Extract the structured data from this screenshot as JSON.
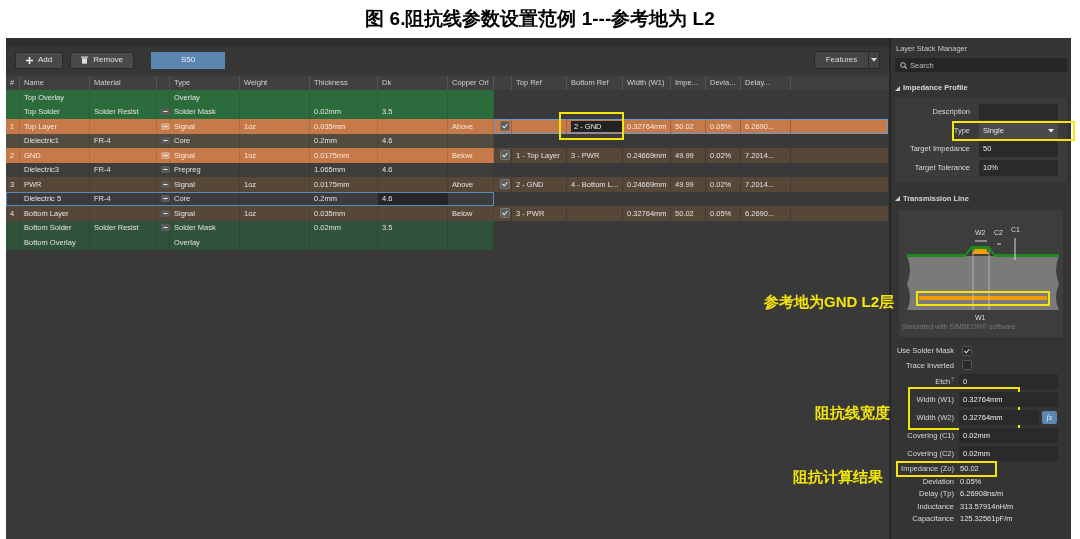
{
  "title": "图 6.阻抗线参数设置范例 1---参考地为 L2",
  "toolbar": {
    "buttons": [
      {
        "label": "Add",
        "kind": "add"
      },
      {
        "label": "Remove",
        "kind": "remove"
      }
    ],
    "tabs": [
      {
        "label": "S50",
        "selected": true
      }
    ],
    "features": "Features"
  },
  "columns": [
    "#",
    "Name",
    "Material",
    "Type",
    "Weight",
    "Thickness",
    "Dk",
    "Copper Ori"
  ],
  "impedance_columns": [
    "Top Ref",
    "Bottom Ref",
    "Width (W1)",
    "Impe...",
    "Devia...",
    "Delay..."
  ],
  "layers": [
    {
      "name": "Top Overlay",
      "type": "Overlay",
      "color": "#2c6b3b",
      "material_button": false,
      "selected": false
    },
    {
      "name": "Top Solder",
      "material": "Solder Resist",
      "type": "Solder Mask",
      "thickness": "0.02mm",
      "dk": "3.5",
      "color": "#2c6b3b",
      "material_button": true,
      "selected": false
    },
    {
      "number": "1",
      "name": "Top Layer",
      "type": "Signal",
      "weight": "1oz",
      "thickness": "0.035mm",
      "copper": "Above",
      "color": "#c67a4a",
      "material_button": true,
      "selected": false,
      "impedance": {
        "checked": true,
        "bottom_ref": "2 - GND",
        "width": "0.32764mm",
        "impedance": "50.02",
        "deviation": "0.05%",
        "delay": "6.2690...",
        "color": "#c67a4a",
        "selected": true,
        "annotated": true
      }
    },
    {
      "name": "Dielectric1",
      "material": "FR-4",
      "type": "Core",
      "thickness": "0.2mm",
      "dk": "4.6",
      "color": "#514b40",
      "material_button": true,
      "selected": false
    },
    {
      "number": "2",
      "name": "GND",
      "type": "Signal",
      "weight": "1oz",
      "thickness": "0.0175mm",
      "copper": "Below",
      "color": "#c67a4a",
      "material_button": true,
      "selected": false,
      "impedance": {
        "checked": true,
        "top_ref": "1 - Top Layer",
        "bottom_ref": "3 - PWR",
        "width": "0.24669mm",
        "impedance": "49.99",
        "deviation": "0.02%",
        "delay": "7.2014...",
        "color": "#574738",
        "selected": false,
        "annotated": false
      }
    },
    {
      "name": "Dielectric3",
      "material": "FR-4",
      "type": "Prepreg",
      "thickness": "1.065mm",
      "dk": "4.6",
      "color": "#403e3a",
      "material_button": true,
      "selected": false
    },
    {
      "number": "3",
      "name": "PWR",
      "type": "Signal",
      "weight": "1oz",
      "thickness": "0.0175mm",
      "copper": "Above",
      "color": "#574738",
      "material_button": true,
      "selected": false,
      "impedance": {
        "checked": true,
        "top_ref": "2 - GND",
        "bottom_ref": "4 - Bottom L...",
        "width": "0.24669mm",
        "impedance": "49.99",
        "deviation": "0.02%",
        "delay": "7.2014...",
        "color": "#574738",
        "selected": false,
        "annotated": false
      }
    },
    {
      "name": "Dielectric 5",
      "material": "FR-4",
      "type": "Core",
      "thickness": "0.2mm",
      "dk": "4.6",
      "color": "#3c3c3c",
      "material_button": true,
      "selected": true
    },
    {
      "number": "4",
      "name": "Bottom Layer",
      "type": "Signal",
      "weight": "1oz",
      "thickness": "0.035mm",
      "copper": "Below",
      "color": "#574738",
      "material_button": true,
      "selected": false,
      "impedance": {
        "checked": true,
        "top_ref": "3 - PWR",
        "width": "0.32764mm",
        "impedance": "50.02",
        "deviation": "0.05%",
        "delay": "6.2690...",
        "color": "#574738",
        "selected": false,
        "annotated": false
      }
    },
    {
      "name": "Bottom Solder",
      "material": "Solder Resist",
      "type": "Solder Mask",
      "thickness": "0.02mm",
      "dk": "3.5",
      "color": "#30513a",
      "material_button": true,
      "selected": false
    },
    {
      "name": "Bottom Overlay",
      "type": "Overlay",
      "color": "#30513a",
      "material_button": false,
      "selected": false
    }
  ],
  "panel": {
    "title": "Layer Stack Manager",
    "search_placeholder": "Search",
    "profile": {
      "heading": "Impedance Profile",
      "expanded": true,
      "fields": [
        {
          "label": "Description",
          "kind": "text",
          "annotated": false
        },
        {
          "label": "Type",
          "value": "Single",
          "kind": "dropdown",
          "annotated": true
        },
        {
          "label": "Target Impedance",
          "value": "50",
          "kind": "text",
          "annotated": false
        },
        {
          "label": "Target Tolerance",
          "value": "10%",
          "kind": "text",
          "annotated": false
        }
      ]
    },
    "transmission": {
      "heading": "Transmission Line",
      "expanded": true,
      "diagram": {
        "w2": "W2",
        "c2": "C2",
        "c1": "C1",
        "w1": "W1",
        "caption": "Simulated with SIMBEOR® software",
        "ground_annotated": true
      },
      "properties": [
        {
          "kind": "checkbox",
          "label": "Use Solder Mask",
          "checked": true,
          "annotated": false
        },
        {
          "kind": "checkbox",
          "label": "Trace Inverted",
          "checked": false,
          "annotated": false
        },
        {
          "kind": "field",
          "label": "Etch",
          "help": "?",
          "value": "0",
          "annotated": false
        },
        {
          "kind": "field",
          "label": "Width (W1)",
          "value": "0.32764mm",
          "annotated": true
        },
        {
          "kind": "field",
          "label": "Width (W2)",
          "value": "0.32764mm",
          "button": "fx",
          "annotated": true
        },
        {
          "kind": "field",
          "label": "Covering (C1)",
          "value": "0.02mm",
          "annotated": false
        },
        {
          "kind": "field",
          "label": "Covering (C2)",
          "value": "0.02mm",
          "annotated": false
        },
        {
          "kind": "readout",
          "label": "Impedance (Zo)",
          "value": "50.02",
          "annotated": true
        },
        {
          "kind": "readout",
          "label": "Deviation",
          "value": "0.05%",
          "annotated": false
        },
        {
          "kind": "readout",
          "label": "Delay (Tp)",
          "value": "6.26908ns/m",
          "annotated": false
        },
        {
          "kind": "readout",
          "label": "Inductance",
          "value": "313.57914nH/m",
          "annotated": false
        },
        {
          "kind": "readout",
          "label": "Capacitance",
          "value": "125.32561pF/m",
          "annotated": false
        }
      ]
    }
  },
  "annotations": [
    "参考地为GND L2层",
    "阻抗线宽度",
    "阻抗计算结果"
  ]
}
